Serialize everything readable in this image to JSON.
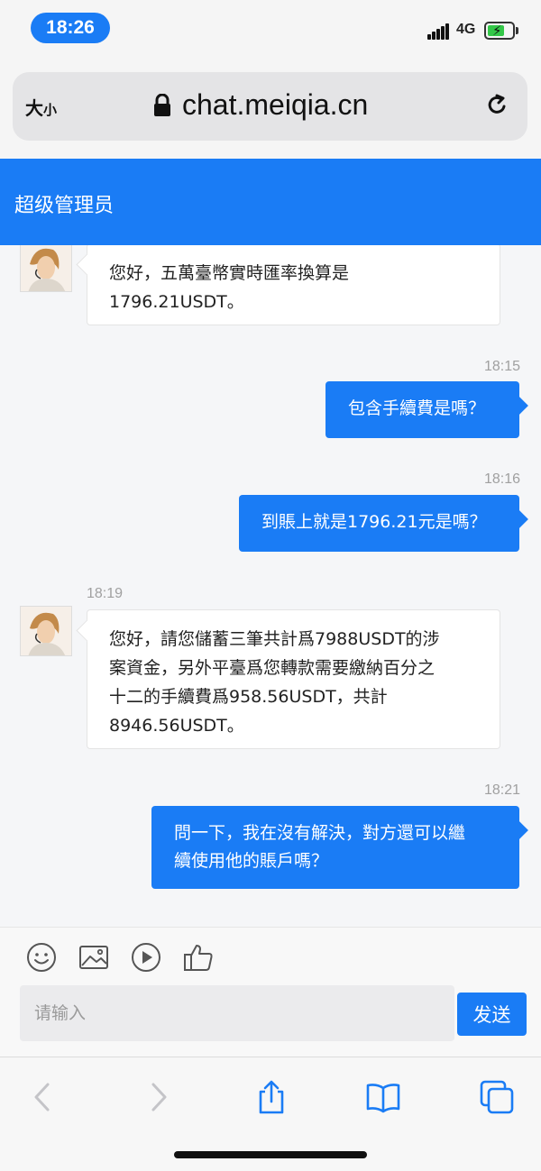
{
  "status_bar": {
    "time": "18:26",
    "network": "4G",
    "battery_level": 0.6,
    "colors": {
      "time_pill": "#1a7cf5",
      "battery_fill": "#33c748"
    }
  },
  "browser": {
    "text_size_main": "大",
    "text_size_small": "小",
    "url": "chat.meiqia.cn"
  },
  "chat": {
    "header_title": "超级管理员",
    "accent_color": "#1a7cf5",
    "messages": [
      {
        "side": "agent",
        "lines": [
          "您好，五萬臺幣實時匯率換算是",
          "1796.21USDT。"
        ]
      },
      {
        "side": "user",
        "time": "18:15",
        "text": "包含手續費是嗎？"
      },
      {
        "side": "user",
        "time": "18:16",
        "text": "到賬上就是1796.21元是嗎？"
      },
      {
        "side": "agent",
        "time": "18:19",
        "lines": [
          "您好，請您儲蓄三筆共計爲7988USDT的涉",
          "案資金，另外平臺爲您轉款需要繳納百分之",
          "十二的手續費爲958.56USDT，共計",
          "8946.56USDT。"
        ]
      },
      {
        "side": "user",
        "time": "18:21",
        "lines": [
          "問一下，我在沒有解決，對方還可以繼",
          "續使用他的賬戶嗎？"
        ]
      }
    ]
  },
  "composer": {
    "tools": [
      "smiley-icon",
      "image-icon",
      "play-icon",
      "thumbs-up-icon"
    ],
    "placeholder": "请输入",
    "send_label": "发送"
  },
  "safari_toolbar": {
    "icons": [
      "back-icon",
      "forward-icon",
      "share-icon",
      "bookmarks-icon",
      "tabs-icon"
    ]
  }
}
